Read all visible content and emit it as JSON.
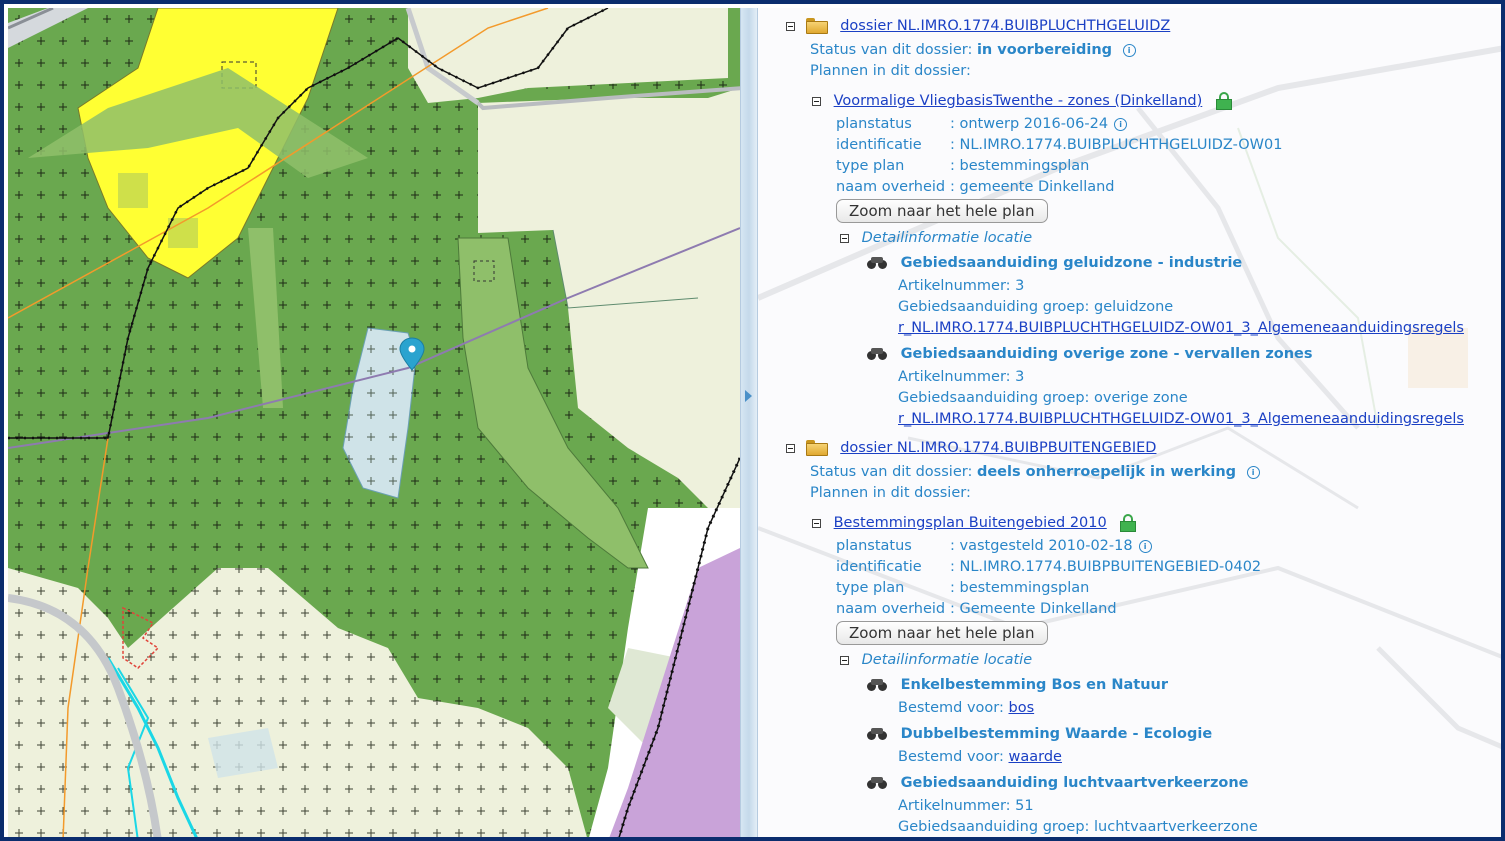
{
  "dossiers": [
    {
      "link": "dossier NL.IMRO.1774.BUIBPLUCHTHGELUIDZ",
      "status_label": "Status van dit dossier:",
      "status_value": "in voorbereiding",
      "plannen_label": "Plannen in dit dossier:",
      "plan": {
        "title": "Voormalige VliegbasisTwenthe - zones (Dinkelland)",
        "fields": [
          {
            "label": "planstatus",
            "value": ": ontwerp 2016-06-24",
            "info": true
          },
          {
            "label": "identificatie",
            "value": ": NL.IMRO.1774.BUIBPLUCHTHGELUIDZ-OW01"
          },
          {
            "label": "type plan",
            "value": ": bestemmingsplan"
          },
          {
            "label": "naam overheid",
            "value": ": gemeente Dinkelland"
          }
        ],
        "zoom_button": "Zoom naar het hele plan",
        "detail_label": "Detailinformatie locatie",
        "details": [
          {
            "title": "Gebiedsaanduiding geluidzone - industrie",
            "lines": [
              "Artikelnummer: 3",
              "Gebiedsaanduiding groep: geluidzone"
            ],
            "link": "r_NL.IMRO.1774.BUIBPLUCHTHGELUIDZ-OW01_3_Algemeneaanduidingsregels"
          },
          {
            "title": "Gebiedsaanduiding overige zone - vervallen zones",
            "lines": [
              "Artikelnummer: 3",
              "Gebiedsaanduiding groep: overige zone"
            ],
            "link": "r_NL.IMRO.1774.BUIBPLUCHTHGELUIDZ-OW01_3_Algemeneaanduidingsregels"
          }
        ]
      }
    },
    {
      "link": "dossier NL.IMRO.1774.BUIBPBUITENGEBIED",
      "status_label": "Status van dit dossier:",
      "status_value": "deels onherroepelijk in werking",
      "plannen_label": "Plannen in dit dossier:",
      "plan": {
        "title": "Bestemmingsplan Buitengebied 2010",
        "fields": [
          {
            "label": "planstatus",
            "value": ": vastgesteld 2010-02-18",
            "info": true
          },
          {
            "label": "identificatie",
            "value": ": NL.IMRO.1774.BUIBPBUITENGEBIED-0402"
          },
          {
            "label": "type plan",
            "value": ": bestemmingsplan"
          },
          {
            "label": "naam overheid",
            "value": ": Gemeente Dinkelland"
          }
        ],
        "zoom_button": "Zoom naar het hele plan",
        "detail_label": "Detailinformatie locatie",
        "details": [
          {
            "title": "Enkelbestemming Bos en Natuur",
            "prefix": "Bestemd voor:",
            "link": "bos"
          },
          {
            "title": "Dubbelbestemming Waarde - Ecologie",
            "prefix": "Bestemd voor:",
            "link": "waarde"
          },
          {
            "title": "Gebiedsaanduiding luchtvaartverkeerzone",
            "lines": [
              "Artikelnummer: 51",
              "Gebiedsaanduiding groep: luchtvaartverkeerzone"
            ]
          }
        ]
      }
    }
  ],
  "colors": {
    "frame": "#0b2d6e",
    "forest_green": "#6aa84f",
    "light_green_path": "#8fbf6a",
    "agri_bg": "#eef1dc",
    "yellow_zone": "#ffff33",
    "purple_zone": "#c9a3d9",
    "water": "#cfe3e8",
    "text_blue": "#2a86c8",
    "link_blue": "#1b40c4"
  }
}
